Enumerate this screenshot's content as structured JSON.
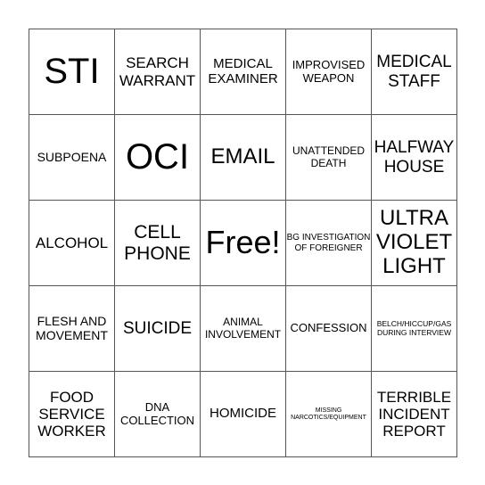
{
  "board": {
    "rows": [
      [
        {
          "text": "STI"
        },
        {
          "text": "SEARCH WARRANT"
        },
        {
          "text": "MEDICAL EXAMINER"
        },
        {
          "text": "IMPROVISED WEAPON"
        },
        {
          "text": "MEDICAL STAFF"
        }
      ],
      [
        {
          "text": "SUBPOENA"
        },
        {
          "text": "OCI"
        },
        {
          "text": "EMAIL"
        },
        {
          "text": "UNATTENDED DEATH"
        },
        {
          "text": "HALFWAY HOUSE"
        }
      ],
      [
        {
          "text": "ALCOHOL"
        },
        {
          "text": "CELL PHONE"
        },
        {
          "text": "Free!"
        },
        {
          "text": "BG INVESTIGATION OF FOREIGNER"
        },
        {
          "text": "ULTRA VIOLET LIGHT"
        }
      ],
      [
        {
          "text": "FLESH AND MOVEMENT"
        },
        {
          "text": "SUICIDE"
        },
        {
          "text": "ANIMAL INVOLVEMENT"
        },
        {
          "text": "CONFESSION"
        },
        {
          "text": "BELCH/HICCUP/GAS DURING INTERVIEW"
        }
      ],
      [
        {
          "text": "FOOD SERVICE WORKER"
        },
        {
          "text": "DNA COLLECTION"
        },
        {
          "text": "HOMICIDE"
        },
        {
          "text": "MISSING NARCOTICS/EQUIPMENT"
        },
        {
          "text": "TERRIBLE INCIDENT REPORT"
        }
      ]
    ]
  }
}
